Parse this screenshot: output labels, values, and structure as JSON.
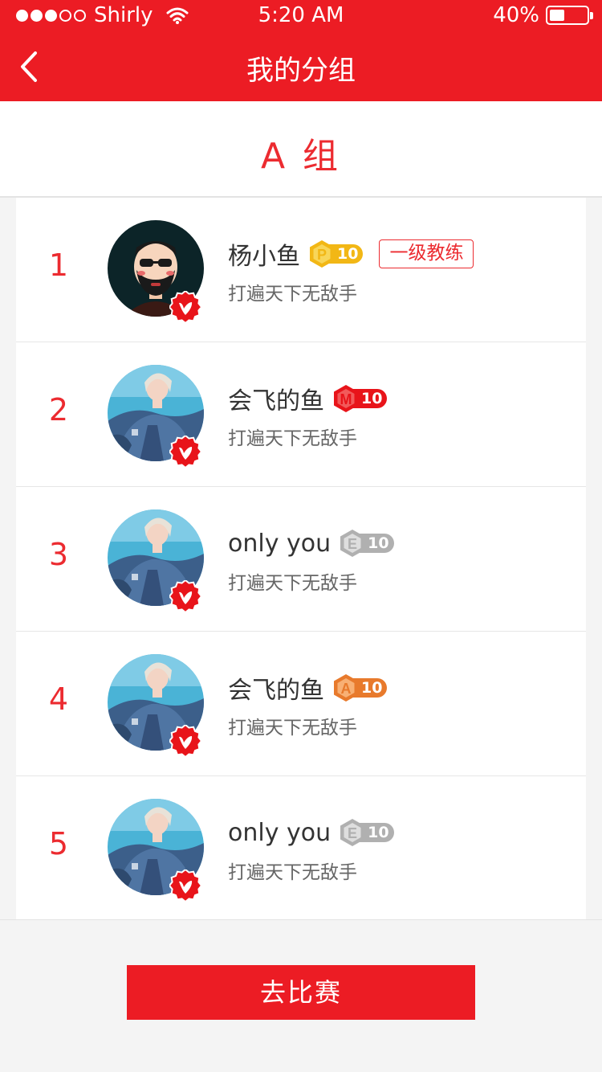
{
  "status": {
    "carrier": "Shirly",
    "time": "5:20 AM",
    "battery_label": "40%",
    "battery_level": 0.4
  },
  "nav": {
    "title": "我的分组"
  },
  "group": {
    "title": "A 组"
  },
  "members": [
    {
      "rank": "1",
      "name": "杨小鱼",
      "level_letter": "P",
      "level_num": "10",
      "level_color": "#f2b715",
      "level_color_light": "#f8d659",
      "role": "一级教练",
      "motto": "打遍天下无敌手",
      "avatar": "cartoon-avatar"
    },
    {
      "rank": "2",
      "name": "会飞的鱼",
      "level_letter": "M",
      "level_num": "10",
      "level_color": "#e8141a",
      "level_color_light": "#f25a5a",
      "role": "",
      "motto": "打遍天下无敌手",
      "avatar": "photo-avatar"
    },
    {
      "rank": "3",
      "name": "only  you",
      "level_letter": "E",
      "level_num": "10",
      "level_color": "#b0b0b0",
      "level_color_light": "#dedede",
      "role": "",
      "motto": "打遍天下无敌手",
      "avatar": "photo-avatar"
    },
    {
      "rank": "4",
      "name": "会飞的鱼",
      "level_letter": "A",
      "level_num": "10",
      "level_color": "#e87a2c",
      "level_color_light": "#f8b074",
      "role": "",
      "motto": "打遍天下无敌手",
      "avatar": "photo-avatar"
    },
    {
      "rank": "5",
      "name": "only  you",
      "level_letter": "E",
      "level_num": "10",
      "level_color": "#b0b0b0",
      "level_color_light": "#dedede",
      "role": "",
      "motto": "打遍天下无敌手",
      "avatar": "photo-avatar"
    }
  ],
  "actions": {
    "go_match_label": "去比赛"
  },
  "colors": {
    "brand_red": "#ec1c24",
    "rank_red": "#ec2b30"
  }
}
